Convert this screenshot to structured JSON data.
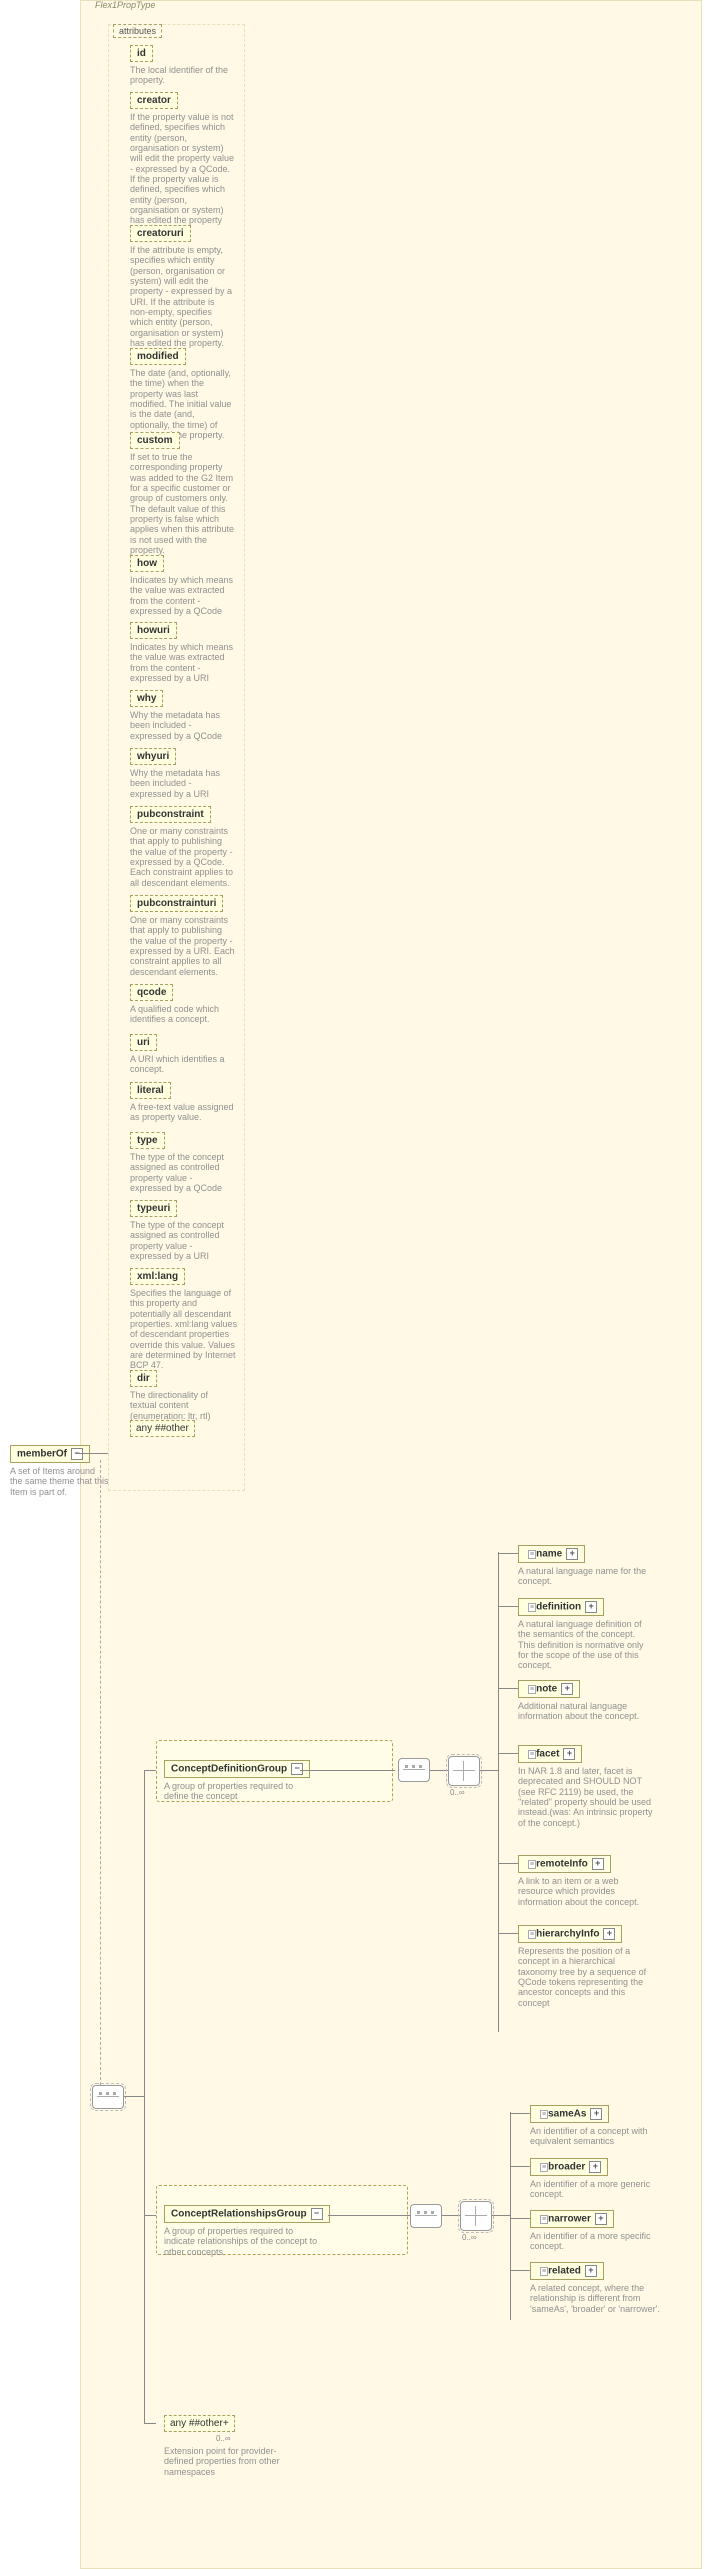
{
  "type_label": "Flex1PropType",
  "attributes_label": "attributes",
  "root": {
    "name": "memberOf",
    "desc": "A set of Items around the same theme that this Item is part of."
  },
  "attrs": [
    {
      "name": "id",
      "desc": "The local identifier of the property."
    },
    {
      "name": "creator",
      "desc": "If the property value is not defined, specifies which entity (person, organisation or system) will edit the property value - expressed by a QCode. If the property value is defined, specifies which entity (person, organisation or system) has edited the property value."
    },
    {
      "name": "creatoruri",
      "desc": "If the attribute is empty, specifies which entity (person, organisation or system) will edit the property - expressed by a URI. If the attribute is non-empty, specifies which entity (person, organisation or system) has edited the property."
    },
    {
      "name": "modified",
      "desc": "The date (and, optionally, the time) when the property was last modified. The initial value is the date (and, optionally, the time) of creation of the property."
    },
    {
      "name": "custom",
      "desc": "If set to true the corresponding property was added to the G2 Item for a specific customer or group of customers only. The default value of this property is false which applies when this attribute is not used with the property."
    },
    {
      "name": "how",
      "desc": "Indicates by which means the value was extracted from the content - expressed by a QCode"
    },
    {
      "name": "howuri",
      "desc": "Indicates by which means the value was extracted from the content - expressed by a URI"
    },
    {
      "name": "why",
      "desc": "Why the metadata has been included - expressed by a QCode"
    },
    {
      "name": "whyuri",
      "desc": "Why the metadata has been included - expressed by a URI"
    },
    {
      "name": "pubconstraint",
      "desc": "One or many constraints that apply to publishing the value of the property - expressed by a QCode. Each constraint applies to all descendant elements."
    },
    {
      "name": "pubconstrainturi",
      "desc": "One or many constraints that apply to publishing the value of the property - expressed by a URI. Each constraint applies to all descendant elements."
    },
    {
      "name": "qcode",
      "desc": "A qualified code which identifies a concept."
    },
    {
      "name": "uri",
      "desc": "A URI which identifies a concept."
    },
    {
      "name": "literal",
      "desc": "A free-text value assigned as property value."
    },
    {
      "name": "type",
      "desc": "The type of the concept assigned as controlled property value - expressed by a QCode"
    },
    {
      "name": "typeuri",
      "desc": "The type of the concept assigned as controlled property value - expressed by a URI"
    },
    {
      "name": "xml:lang",
      "desc": "Specifies the language of this property and potentially all descendant properties. xml:lang values of descendant properties override this value. Values are determined by Internet BCP 47."
    },
    {
      "name": "dir",
      "desc": "The directionality of textual content (enumeration: ltr, rtl)"
    }
  ],
  "any_attr_label": "any ##other",
  "groups": {
    "definition": {
      "label": "ConceptDefinitionGroup",
      "desc": "A group of properties required to define the concept",
      "occ": "0..∞",
      "children": [
        {
          "name": "name",
          "desc": "A natural language name for the concept."
        },
        {
          "name": "definition",
          "desc": "A natural language definition of the semantics of the concept. This definition is normative only for the scope of the use of this concept."
        },
        {
          "name": "note",
          "desc": "Additional natural language information about the concept."
        },
        {
          "name": "facet",
          "desc": "In NAR 1.8 and later, facet is deprecated and SHOULD NOT (see RFC 2119) be used, the \"related\" property should be used instead.(was: An intrinsic property of the concept.)"
        },
        {
          "name": "remoteInfo",
          "desc": "A link to an item or a web resource which provides information about the concept."
        },
        {
          "name": "hierarchyInfo",
          "desc": "Represents the position of a concept in a hierarchical taxonomy tree by a sequence of QCode tokens representing the ancestor concepts and this concept"
        }
      ]
    },
    "relationships": {
      "label": "ConceptRelationshipsGroup",
      "desc": "A group of properties required to indicate relationships of the concept to other concepts",
      "occ": "0..∞",
      "children": [
        {
          "name": "sameAs",
          "desc": "An identifier of a concept with equivalent semantics"
        },
        {
          "name": "broader",
          "desc": "An identifier of a more generic concept."
        },
        {
          "name": "narrower",
          "desc": "An identifier of a more specific concept."
        },
        {
          "name": "related",
          "desc": "A related concept, where the relationship is different from 'sameAs', 'broader' or 'narrower'."
        }
      ]
    }
  },
  "extension": {
    "label": "any ##other",
    "desc": "Extension point for provider-defined properties from other namespaces",
    "occ": "0..∞"
  }
}
